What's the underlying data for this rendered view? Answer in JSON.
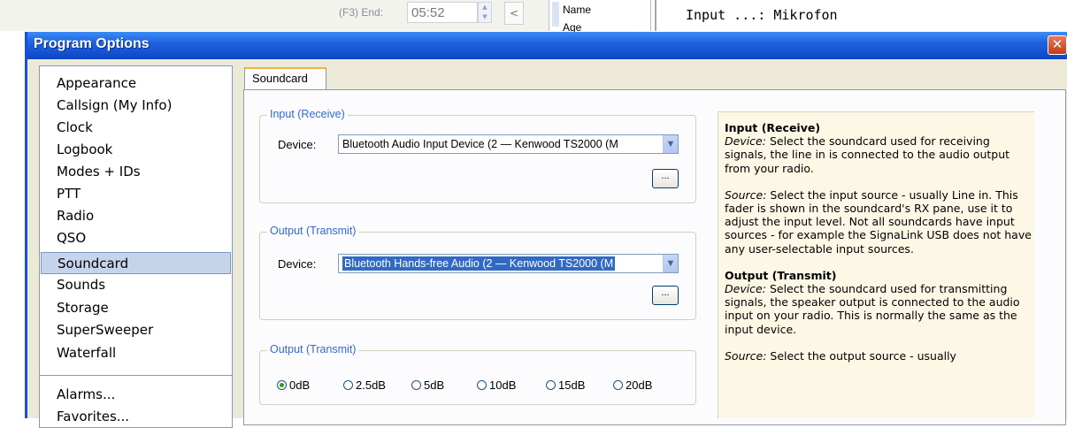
{
  "background": {
    "end_label": "(F3)  End:",
    "end_time": "05:52",
    "arrow": "<",
    "table_headers": [
      "Name",
      "Age"
    ],
    "console_text": "Input ...: Mikrofon"
  },
  "dialog": {
    "title": "Program Options",
    "close_glyph": "✕"
  },
  "nav": {
    "items": [
      "Appearance",
      "Callsign (My Info)",
      "Clock",
      "Logbook",
      "Modes + IDs",
      "PTT",
      "Radio",
      "QSO",
      "Soundcard",
      "Sounds",
      "Storage",
      "SuperSweeper",
      "Waterfall"
    ],
    "selected": "Soundcard",
    "items2": [
      "Alarms...",
      "Favorites..."
    ]
  },
  "tab": {
    "label": "Soundcard"
  },
  "input_group": {
    "legend": "Input (Receive)",
    "device_label": "Device:",
    "device_value": "Bluetooth Audio Input Device (2 — Kenwood TS2000 (M",
    "browse_label": "..."
  },
  "output_group": {
    "legend": "Output (Transmit)",
    "device_label": "Device:",
    "device_value": "Bluetooth Hands-free Audio (2 — Kenwood TS2000 (M",
    "browse_label": "..."
  },
  "level_group": {
    "legend": "Output (Transmit)",
    "options": [
      "0dB",
      "2.5dB",
      "5dB",
      "10dB",
      "15dB",
      "20dB"
    ],
    "selected": "0dB"
  },
  "help": {
    "input_heading": "Input (Receive)",
    "input_device_term": "Device:",
    "input_device_text": " Select the soundcard used for receiving signals, the line in is connected to the audio output from your radio.",
    "input_source_term": "Source:",
    "input_source_text": " Select the input source - usually Line in. This fader is shown in the soundcard's RX pane, use it to adjust the input level. Not all soundcards have input sources - for example the SignaLink USB does not have any user-selectable input sources.",
    "output_heading": "Output (Transmit)",
    "output_device_term": "Device:",
    "output_device_text": " Select the soundcard used for transmitting signals, the speaker output is connected to the audio input on your radio. This is normally the same as the input device.",
    "output_source_term": "Source:",
    "output_source_text": " Select the output source - usually"
  }
}
